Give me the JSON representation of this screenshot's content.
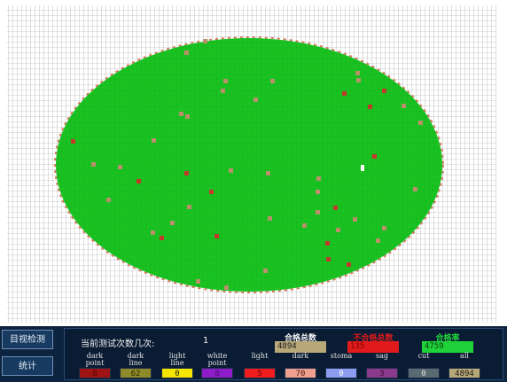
{
  "colors": {
    "wafer_green": "#19c221",
    "grid_line": "#9a9a9a",
    "defect_red": "#c0392b",
    "defect_tan": "#b9906a",
    "panel_bg": "#0a1c33"
  },
  "sidebar": {
    "button_1": "目视检测",
    "button_2": "统计"
  },
  "info": {
    "label": "当前测试次数几次:",
    "value": "1"
  },
  "summary": [
    {
      "label": "合格总数",
      "value": "4894",
      "label_color": "#f2f2f2",
      "box_bg": "#b8a878",
      "text_color": "#1a1a1a"
    },
    {
      "label": "不合格总数",
      "value": "135",
      "label_color": "#e11b1b",
      "box_bg": "#e11b1b",
      "text_color": "#7a0000"
    },
    {
      "label": "合格率",
      "value": "4759",
      "label_color": "#22d63a",
      "box_bg": "#1fd23a",
      "text_color": "#0a3a10"
    }
  ],
  "categories": [
    {
      "label": "dark\npoint",
      "value": "8",
      "bg": "#9e1414",
      "fg": "#5a0000"
    },
    {
      "label": "dark\nline",
      "value": "62",
      "bg": "#8f8a2a",
      "fg": "#2a2800"
    },
    {
      "label": "light\nline",
      "value": "0",
      "bg": "#f5e600",
      "fg": "#1a1a00"
    },
    {
      "label": "white\npoint",
      "value": "8",
      "bg": "#8e1cc9",
      "fg": "#4a0a70"
    },
    {
      "label": "light",
      "value": "5",
      "bg": "#ee1c1c",
      "fg": "#6a0000"
    },
    {
      "label": "dark",
      "value": "70",
      "bg": "#ee9f8f",
      "fg": "#4a1a10"
    },
    {
      "label": "stoma",
      "value": "0",
      "bg": "#8c9cf0",
      "fg": "#ffffff"
    },
    {
      "label": "sag",
      "value": "3",
      "bg": "#8a3a8a",
      "fg": "#3a0a3a"
    },
    {
      "label": "cut",
      "value": "0",
      "bg": "#5a6a72",
      "fg": "#e0e0e0"
    },
    {
      "label": "all",
      "value": "4894",
      "bg": "#b8a878",
      "fg": "#1a1a1a"
    }
  ]
}
